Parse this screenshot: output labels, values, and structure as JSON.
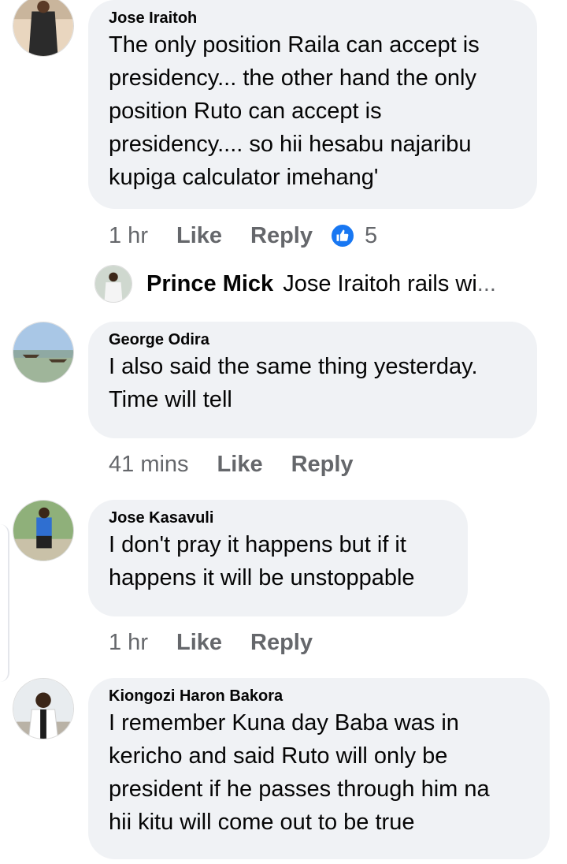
{
  "comments": [
    {
      "author": "Jose Iraitoh",
      "text_lines": [
        "The only position Raila can accept is",
        "presidency... the other hand the only",
        "position Ruto can accept is",
        "presidency.... so hii hesabu najaribu",
        "kupiga calculator imehang'"
      ],
      "time": "1 hr",
      "like_label": "Like",
      "reply_label": "Reply",
      "reaction_icon": "thumbs-up-icon",
      "reaction_count": "5"
    },
    {
      "author": "George Odira",
      "text_lines": [
        "I also said the same thing yesterday.",
        "Time will tell"
      ],
      "time": "41 mins",
      "like_label": "Like",
      "reply_label": "Reply"
    },
    {
      "author": "Jose Kasavuli",
      "text_lines": [
        "I don't pray it happens but if it",
        "happens it will be unstoppable"
      ],
      "time": "1 hr",
      "like_label": "Like",
      "reply_label": "Reply"
    },
    {
      "author": "Kiongozi Haron Bakora",
      "text_lines": [
        "I remember Kuna day Baba was in",
        "kericho and said Ruto will only be",
        "president if he passes through him na",
        "hii kitu will come out to be true"
      ]
    }
  ],
  "reply_preview": {
    "author": "Prince Mick",
    "snippet": "Jose Iraitoh rails wi",
    "ellipsis": "..."
  },
  "colors": {
    "bubble": "#f0f2f5",
    "meta_text": "#65676b",
    "reaction_blue": "#1877f2"
  }
}
